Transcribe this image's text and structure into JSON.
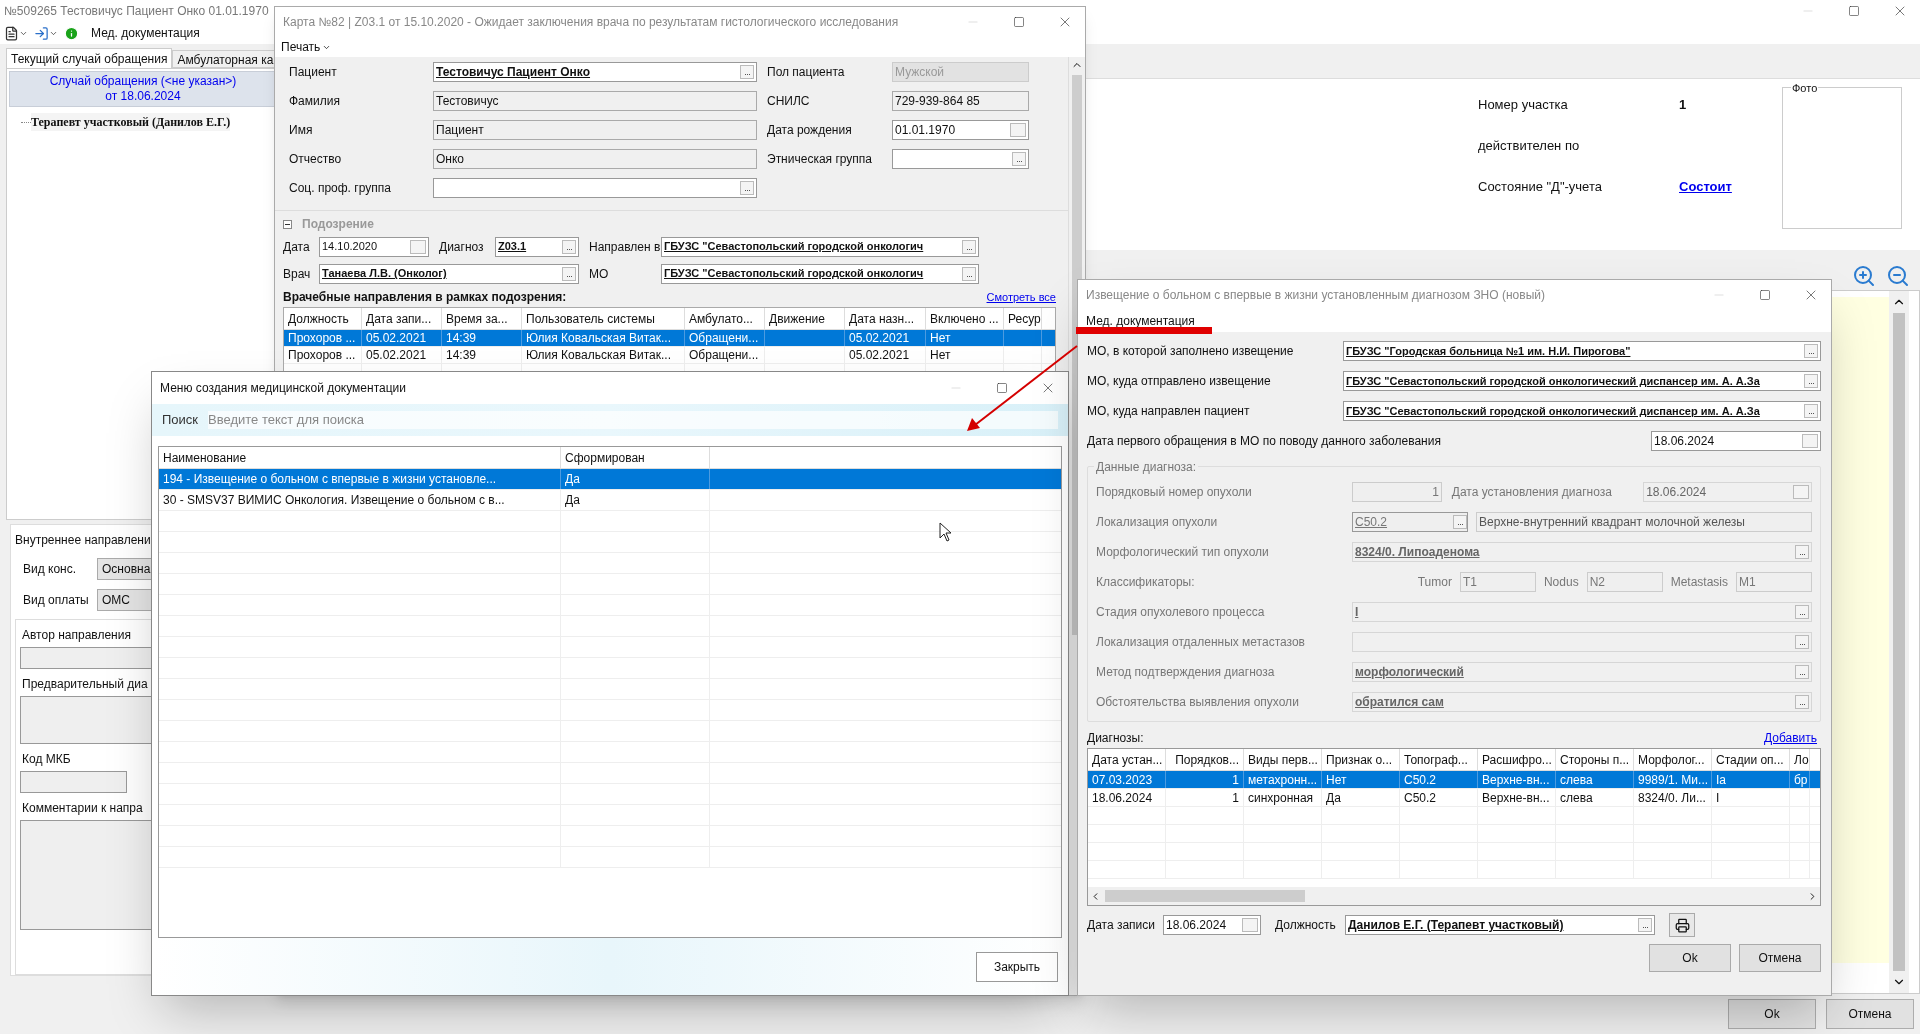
{
  "main_window": {
    "title": "№509265 Тестовичус Пациент Онко 01.01.1970",
    "toolbar": {
      "label": "Мед. документация"
    },
    "tabs": [
      {
        "label": "Текущий случай обращения",
        "selected": true
      },
      {
        "label": "Амбулаторная ка",
        "selected": false
      }
    ],
    "case": {
      "title": "Случай обращения (<не указан>)",
      "date": "от 18.06.2024",
      "tree": [
        {
          "label": "Терапевт участковый (Данилов Е.Г.)"
        }
      ]
    },
    "internal_referral": {
      "title": "Внутреннее направлени",
      "fields": [
        {
          "label": "Вид конс.",
          "value": "Основна"
        },
        {
          "label": "Вид оплаты",
          "value": "ОМС"
        }
      ],
      "sections": [
        {
          "label": "Автор направления",
          "kind": "line"
        },
        {
          "label": "Предварительный диа",
          "kind": "area"
        },
        {
          "label": "Код МКБ",
          "kind": "short"
        },
        {
          "label": "Комментарии к напра",
          "kind": "tall"
        }
      ]
    },
    "info": [
      {
        "label": "Номер участка",
        "value": "1",
        "kind": "bold"
      },
      {
        "label": "действителен по"
      },
      {
        "label": "Состояние \"Д\"-учета",
        "value": "Состоит",
        "kind": "link"
      }
    ],
    "photo": {
      "label": "Фото"
    },
    "buttons": [
      "Ok",
      "Отмена"
    ]
  },
  "card_window": {
    "title": "Карта №82 | Z03.1 от 15.10.2020 - Ожидает заключения врача по результатам гистологического исследования",
    "menu": "Печать",
    "left_fields": [
      {
        "label": "Пациент",
        "value": "Тестовичус Пациент Онко",
        "kind": "ref"
      },
      {
        "label": "Фамилия",
        "value": "Тестовичус",
        "kind": "text"
      },
      {
        "label": "Имя",
        "value": "Пациент",
        "kind": "text"
      },
      {
        "label": "Отчество",
        "value": "Онко",
        "kind": "text"
      },
      {
        "label": "Соц. проф. группа",
        "kind": "lookup"
      }
    ],
    "right_fields": [
      {
        "label": "Пол пациента",
        "value": "Мужской",
        "kind": "combo"
      },
      {
        "label": "СНИЛС",
        "value": "729-939-864 85",
        "kind": "text"
      },
      {
        "label": "Дата рождения",
        "value": "01.01.1970",
        "kind": "date"
      },
      {
        "label": "Этническая группа",
        "kind": "lookup"
      }
    ],
    "suspicion": {
      "title": "Подозрение",
      "expanded": true,
      "date": {
        "label": "Дата",
        "value": "14.10.2020",
        "kind": "date"
      },
      "diagnosis": {
        "label": "Диагноз",
        "value": "Z03.1",
        "kind": "ref"
      },
      "directed_to": {
        "label": "Направлен в",
        "value": "ГБУЗС \"Севастопольский городской онкологич",
        "kind": "ref"
      },
      "doctor": {
        "label": "Врач",
        "value": "Танаева Л.В. (Онколог)",
        "kind": "ref"
      },
      "mo": {
        "label": "МО",
        "value": "ГБУЗС \"Севастопольский городской онкологич",
        "kind": "ref"
      }
    },
    "referrals": {
      "title": "Врачебные направления в рамках подозрения:",
      "link": "Смотреть все",
      "columns": [
        "Должность",
        "Дата запи...",
        "Время за...",
        "Пользователь системы",
        "Амбулато...",
        "Движение",
        "Дата назн...",
        "Включено ...",
        "Ресур"
      ],
      "rows": [
        {
          "selected": true,
          "cells": [
            "Прохоров ...",
            "05.02.2021",
            "14:39",
            "Юлия Ковальская Витак...",
            "Обращени...",
            null,
            "05.02.2021",
            "Нет",
            null
          ]
        },
        {
          "selected": false,
          "cells": [
            "Прохоров ...",
            "05.02.2021",
            "14:39",
            "Юлия Ковальская Витак...",
            "Обращени...",
            null,
            "05.02.2021",
            "Нет",
            null
          ]
        }
      ]
    }
  },
  "docs_menu_window": {
    "title": "Меню создания медицинской документации",
    "search": {
      "label": "Поиск",
      "placeholder": "Введите текст для поиска"
    },
    "columns": [
      "Наименование",
      "Сформирован"
    ],
    "rows": [
      {
        "selected": true,
        "cells": [
          "194 - Извещение о больном с впервые в жизни установле...",
          "Да"
        ]
      },
      {
        "selected": false,
        "cells": [
          "30 - SMSV37 ВИМИС Онкология. Извещение о больном с в...",
          "Да"
        ]
      }
    ],
    "button": "Закрыть"
  },
  "notice_window": {
    "title": "Извещение о больном с впервые в жизни установленным диагнозом ЗНО (новый)",
    "menu": "Мед. документация",
    "fields": [
      {
        "label": "МО, в которой заполнено извещение",
        "value": "ГБУЗС \"Городская больница №1 им. Н.И. Пирогова\"",
        "kind": "ref"
      },
      {
        "label": "МО, куда отправлено извещение",
        "value": "ГБУЗС \"Севастопольский городской онкологический диспансер им. А. А.За",
        "kind": "ref"
      },
      {
        "label": "МО, куда направлен пациент",
        "value": "ГБУЗС \"Севастопольский городской онкологический диспансер им. А. А.За",
        "kind": "ref"
      },
      {
        "label": "Дата первого обращения в МО по поводу данного заболевания",
        "value": "18.06.2024",
        "kind": "date"
      }
    ],
    "diagnosis_data": {
      "title": "Данные диагноза:",
      "disabled": true,
      "serial": {
        "label": "Порядковый номер опухоли",
        "value": "1"
      },
      "date": {
        "label": "Дата установления диагноза",
        "value": "18.06.2024"
      },
      "localization": {
        "label": "Локализация опухоли",
        "code": "C50.2",
        "text": "Верхне-внутренний квадрант молочной железы"
      },
      "classifiers": {
        "label": "Классификаторы:",
        "items": [
          {
            "label": "Tumor",
            "value": "T1"
          },
          {
            "label": "Nodus",
            "value": "N2"
          },
          {
            "label": "Metastasis",
            "value": "M1"
          }
        ]
      },
      "rows": [
        {
          "label": "Морфологический тип опухоли",
          "value": "8324/0. Липоаденома"
        },
        {
          "label": "Стадия опухолевого процесса",
          "value": "I"
        },
        {
          "label": "Локализация отдаленных метастазов"
        },
        {
          "label": "Метод подтверждения диагноза",
          "value": "морфологический"
        },
        {
          "label": "Обстоятельства выявления опухоли",
          "value": "обратился сам"
        }
      ]
    },
    "diagnoses": {
      "title": "Диагнозы:",
      "link": "Добавить",
      "columns": [
        "Дата устан...",
        "Порядков...",
        "Виды перв...",
        "Признак о...",
        "Топограф...",
        "Расшифро...",
        "Стороны п...",
        "Морфолог...",
        "Стадии оп...",
        "Ло"
      ],
      "rows": [
        {
          "selected": true,
          "cells": [
            "07.03.2023",
            "1",
            "метахронн...",
            "Нет",
            "C50.2",
            "Верхне-вн...",
            "слева",
            "9989/1. Ми...",
            "Ia",
            "бр"
          ]
        },
        {
          "selected": false,
          "cells": [
            "18.06.2024",
            "1",
            "синхронная",
            "Да",
            "C50.2",
            "Верхне-вн...",
            "слева",
            "8324/0. Ли...",
            "I",
            null
          ]
        }
      ]
    },
    "record_date": {
      "label": "Дата записи",
      "value": "18.06.2024"
    },
    "position": {
      "label": "Должность",
      "value": "Данилов Е.Г. (Терапевт участковый)"
    },
    "buttons": [
      "Ok",
      "Отмена"
    ]
  }
}
